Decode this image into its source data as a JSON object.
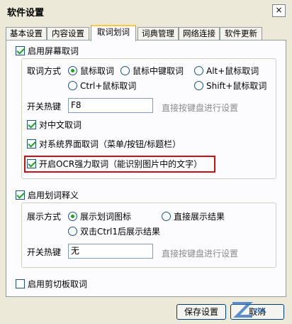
{
  "window": {
    "title": "软件设置",
    "close_glyph": "×"
  },
  "tabs": [
    {
      "label": "基本设置"
    },
    {
      "label": "内容设置"
    },
    {
      "label": "取词划词"
    },
    {
      "label": "词典管理"
    },
    {
      "label": "网络连接"
    },
    {
      "label": "软件更新"
    }
  ],
  "active_tab": "取词划词",
  "screen_capture": {
    "enable_label": "启用屏幕取词",
    "enabled": true,
    "mode_label": "取词方式",
    "modes": [
      {
        "label": "鼠标取词",
        "selected": true
      },
      {
        "label": "鼠标中键取词",
        "selected": false
      },
      {
        "label": "Alt+鼠标取词",
        "selected": false
      },
      {
        "label": "Ctrl+鼠标取词",
        "selected": false
      },
      {
        "label": "Shift+鼠标取词",
        "selected": false
      }
    ],
    "hotkey_label": "开关热键",
    "hotkey_value": "F8",
    "hotkey_hint": "直接按键盘进行设置",
    "chinese_label": "对中文取词",
    "chinese_checked": true,
    "system_ui_label": "对系统界面取词（菜单/按钮/标题栏）",
    "system_ui_checked": true,
    "ocr_label": "开启OCR强力取词（能识别图片中的文字）",
    "ocr_checked": true
  },
  "selection_translate": {
    "enable_label": "启用划词释义",
    "enabled": true,
    "mode_label": "展示方式",
    "modes": [
      {
        "label": "展示划词图标",
        "selected": true
      },
      {
        "label": "直接展示结果",
        "selected": false
      },
      {
        "label": "双击Ctrl1后展示结果",
        "selected": false
      }
    ],
    "hotkey_label": "开关热键",
    "hotkey_value": "无",
    "hotkey_hint": "直接按键盘进行设置"
  },
  "clipboard": {
    "label": "启用剪切板取词",
    "checked": false
  },
  "buttons": {
    "save": "保存设置",
    "cancel": "取消"
  },
  "watermark": {
    "text": "ZOL"
  },
  "colors": {
    "highlight_box": "#cc1010",
    "check": "#21a121",
    "tab_accent": "#ffc83c"
  }
}
